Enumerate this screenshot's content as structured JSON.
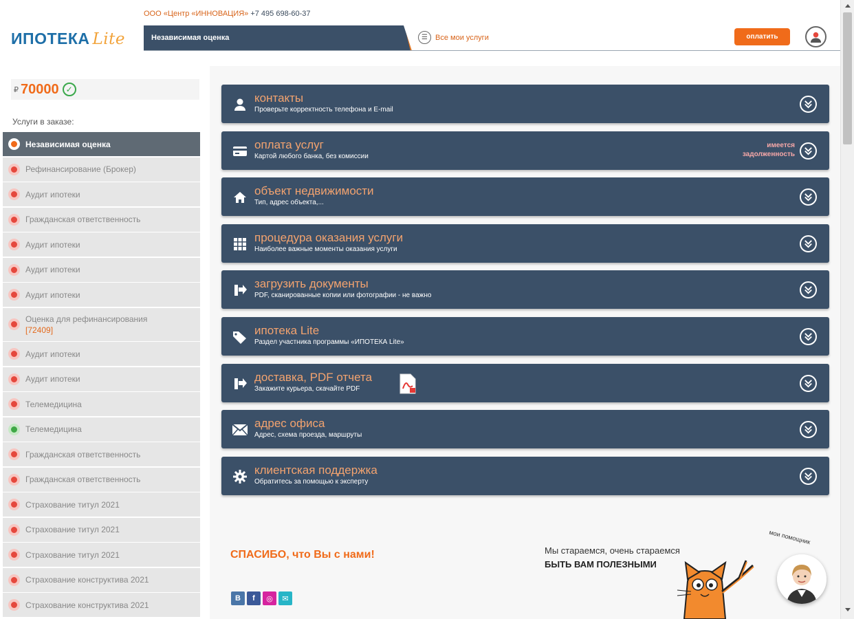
{
  "header": {
    "company": "ООО «Центр «ИННОВАЦИЯ»",
    "phone": "+7 495 698-60-37",
    "logo_main": "ИПОТЕКА",
    "logo_accent": "Lite",
    "current_service": "Независимая оценка",
    "all_services_label": "Все мои услуги",
    "pay_button": "оплатить"
  },
  "sidebar": {
    "price_prefix": "₽",
    "price": "70000",
    "services_label": "Услуги в заказе:",
    "items": [
      {
        "label": "Независимая оценка",
        "status": "active"
      },
      {
        "label": "Рефинансирование (Брокер)",
        "status": "red"
      },
      {
        "label": "Аудит ипотеки",
        "status": "red"
      },
      {
        "label": "Гражданская ответственность",
        "status": "red"
      },
      {
        "label": "Аудит ипотеки",
        "status": "red"
      },
      {
        "label": "Аудит ипотеки",
        "status": "red"
      },
      {
        "label": "Аудит ипотеки",
        "status": "red"
      },
      {
        "label": "Оценка для рефинансирования",
        "code": "[72409]",
        "status": "red"
      },
      {
        "label": "Аудит ипотеки",
        "status": "red"
      },
      {
        "label": "Аудит ипотеки",
        "status": "red"
      },
      {
        "label": "Телемедицина",
        "status": "red"
      },
      {
        "label": "Телемедицина",
        "status": "green"
      },
      {
        "label": "Гражданская ответственность",
        "status": "red"
      },
      {
        "label": "Гражданская ответственность",
        "status": "red"
      },
      {
        "label": "Страхование титул 2021",
        "status": "red"
      },
      {
        "label": "Страхование титул 2021",
        "status": "red"
      },
      {
        "label": "Страхование титул 2021",
        "status": "red"
      },
      {
        "label": "Страхование конструктива 2021",
        "status": "red"
      },
      {
        "label": "Страхование конструктива 2021",
        "status": "red"
      }
    ]
  },
  "panels": [
    {
      "icon": "user-icon",
      "title": "контакты",
      "subtitle": "Проверьте корректность телефона и E-mail"
    },
    {
      "icon": "credit-card-icon",
      "title": "оплата услуг",
      "subtitle": "Картой любого банка, без комиссии",
      "warning_line1": "имеется",
      "warning_line2": "задолженность"
    },
    {
      "icon": "home-icon",
      "title": "объект недвижимости",
      "subtitle": "Тип, адрес объекта,..."
    },
    {
      "icon": "grid-icon",
      "title": "процедура оказания услуги",
      "subtitle": "Наиболее важные моменты оказания услуги"
    },
    {
      "icon": "upload-icon",
      "title": "загрузить документы",
      "subtitle": "PDF, сканированные копии или фотографии - не важно"
    },
    {
      "icon": "tag-icon",
      "title": "ипотека Lite",
      "subtitle": "Раздел участника программы «ИПОТЕКА Lite»"
    },
    {
      "icon": "delivery-icon",
      "title": "доставка, PDF отчета",
      "subtitle": "Закажите курьера, скачайте PDF"
    },
    {
      "icon": "envelope-icon",
      "title": "адрес офиса",
      "subtitle": "Адрес, схема проезда, маршруты"
    },
    {
      "icon": "gear-icon",
      "title": "клиентская поддержка",
      "subtitle": "Обратитесь за помощью к эксперту"
    }
  ],
  "footer": {
    "thanks": "СПАСИБО, что Вы с нами!",
    "slogan_line1": "Мы стараемся, очень стараемся",
    "slogan_line2": "БЫТЬ ВАМ ПОЛЕЗНЫМИ",
    "assistant_caption": "мои помощник",
    "social": [
      {
        "icon": "vk-icon",
        "glyph": "B",
        "color": "#4a76a8"
      },
      {
        "icon": "facebook-icon",
        "glyph": "f",
        "color": "#3b5998"
      },
      {
        "icon": "instagram-icon",
        "glyph": "◎",
        "color": "#d6249f"
      },
      {
        "icon": "email-icon",
        "glyph": "✉",
        "color": "#27b5c7"
      }
    ]
  },
  "colors": {
    "accent": "#f06b1a",
    "panel": "#3b5068",
    "logo_blue": "#1e6fa8",
    "panel_title": "#f3a36f"
  }
}
